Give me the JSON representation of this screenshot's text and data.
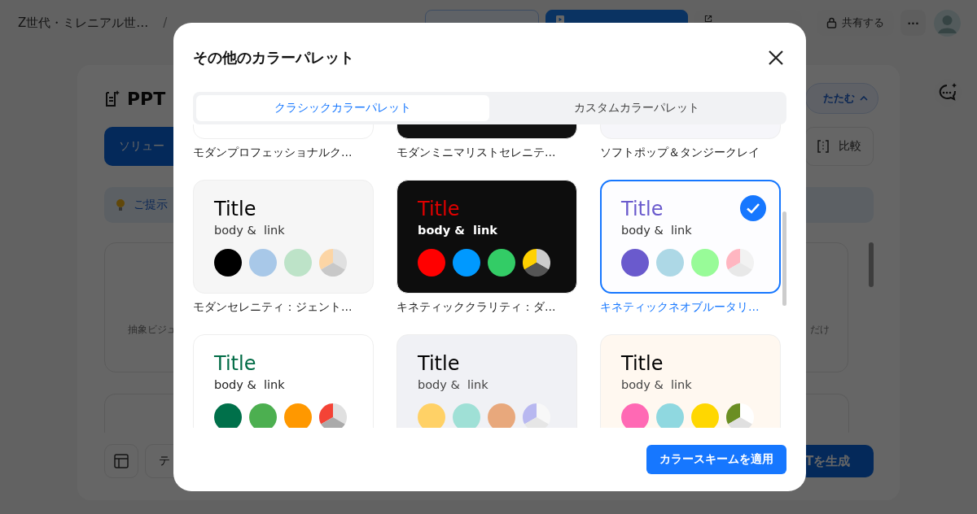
{
  "topbar": {
    "title": "Z世代・ミレニアル世…",
    "separator": "/",
    "buttons": [
      {
        "kind": "outline"
      },
      {
        "kind": "primary"
      },
      {
        "kind": "export"
      },
      {
        "label": "共有する",
        "kind": "share"
      },
      {
        "label": "···",
        "kind": "more"
      }
    ]
  },
  "background": {
    "heading": "PPT",
    "collapse": "たたむ",
    "primary_tab": "ソリュー",
    "compare": "比較",
    "tip": "ご提示",
    "card_left": "抽象ビジュ",
    "card_right": "だけ",
    "input": "テ",
    "generate": "Tを生成"
  },
  "dialog": {
    "title": "その他のカラーパレット",
    "tabs": [
      {
        "label": "クラシックカラーパレット",
        "selected": true
      },
      {
        "label": "カスタムカラーパレット",
        "selected": false
      }
    ],
    "palettes": [
      {
        "name": "モダンプロフェッショナルク…",
        "color": "#ffffff",
        "selected": false
      },
      {
        "name": "モダンミニマリストセレニテ…",
        "color": "#111111",
        "selected": false
      },
      {
        "name": "ソフトポップ＆タンジークレイ",
        "color": "#f6f6fa",
        "selected": false
      },
      {
        "name": "モダンセレニティ：ジェント…",
        "color": "#f6f6f6",
        "selected": false,
        "title": {
          "text": "Title",
          "color": "#000000"
        },
        "body": {
          "text": "body &  link",
          "color": "#333333",
          "bold": false
        },
        "swatches": [
          {
            "color": "#000000"
          },
          {
            "color": "#a8c8e8"
          },
          {
            "color": "#bde3c8"
          }
        ],
        "pie": [
          {
            "color": "#fcd5a5"
          },
          {
            "color": "#e0e0e0"
          },
          {
            "color": "#c8c8c8"
          }
        ]
      },
      {
        "name": "キネティッククラリティ：ダ…",
        "color": "#0d0d0d",
        "selected": false,
        "title": {
          "text": "Title",
          "color": "#e00000"
        },
        "body": {
          "text": "body &  link",
          "color": "#ffffff",
          "bold": true
        },
        "swatches": [
          {
            "color": "#ff0000"
          },
          {
            "color": "#0099ff"
          },
          {
            "color": "#33cc66"
          }
        ],
        "pie": [
          {
            "color": "#ffd100"
          },
          {
            "color": "#cccccc"
          },
          {
            "color": "#555555"
          }
        ]
      },
      {
        "name": "キネティックネオブルータリ…",
        "color": "#fdfdff",
        "selected": true,
        "title": {
          "text": "Title",
          "color": "#6a5acd"
        },
        "body": {
          "text": "body &  link",
          "color": "#333333",
          "bold": false
        },
        "swatches": [
          {
            "color": "#6a5acd"
          },
          {
            "color": "#add8e6"
          },
          {
            "color": "#98fb98"
          }
        ],
        "pie": [
          {
            "color": "#ffb6c1"
          },
          {
            "color": "#f2f2f2"
          },
          {
            "color": "#e8e8e8"
          }
        ]
      },
      {
        "color": "#ffffff",
        "selected": false,
        "title": {
          "text": "Title",
          "color": "#006b45"
        },
        "body": {
          "text": "body &  link",
          "color": "#222222",
          "bold": false
        },
        "swatches": [
          {
            "color": "#00704a"
          },
          {
            "color": "#4caf50"
          },
          {
            "color": "#ff9800"
          }
        ],
        "pie": [
          {
            "color": "#f44336"
          },
          {
            "color": "#e0e0e0"
          },
          {
            "color": "#aaaaaa"
          }
        ]
      },
      {
        "color": "#f0f1f5",
        "selected": false,
        "title": {
          "text": "Title",
          "color": "#000000"
        },
        "body": {
          "text": "body &  link",
          "color": "#444444",
          "bold": false
        },
        "swatches": [
          {
            "color": "#ffd166"
          },
          {
            "color": "#9fe0d6"
          },
          {
            "color": "#e8a87c"
          }
        ],
        "pie": [
          {
            "color": "#b8b8f0"
          },
          {
            "color": "#f8f8f8"
          },
          {
            "color": "#e6e6e6"
          }
        ]
      },
      {
        "color": "#fff8f0",
        "selected": false,
        "title": {
          "text": "Title",
          "color": "#000000"
        },
        "body": {
          "text": "body &  link",
          "color": "#444444",
          "bold": false
        },
        "swatches": [
          {
            "color": "#ff69b4"
          },
          {
            "color": "#8fd8e0"
          },
          {
            "color": "#ffd700"
          }
        ],
        "pie": [
          {
            "color": "#6b8e23"
          },
          {
            "color": "#ffffff"
          },
          {
            "color": "#e0e0e0"
          }
        ]
      }
    ],
    "apply": "カラースキームを適用"
  }
}
